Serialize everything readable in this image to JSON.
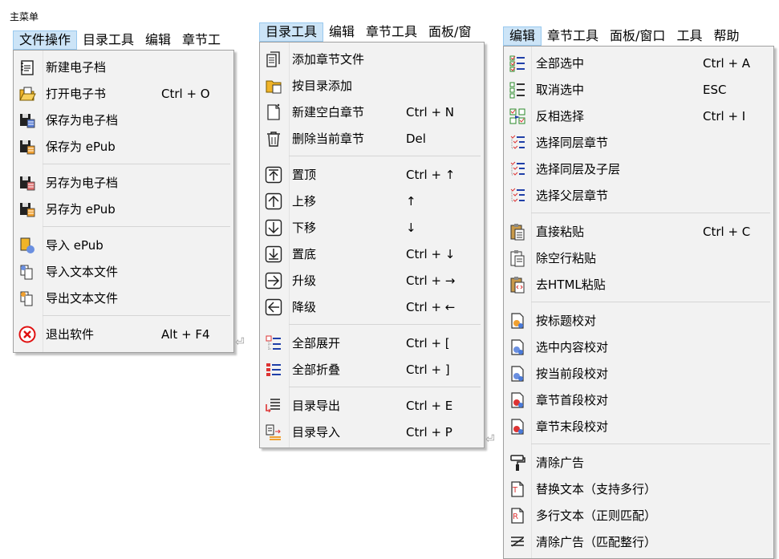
{
  "caption": "主菜单",
  "menu1": {
    "tabs": [
      "文件操作",
      "目录工具",
      "编辑",
      "章节工"
    ],
    "items": [
      {
        "label": "新建电子档",
        "shortcut": "",
        "icon": "new-ebook-icon"
      },
      {
        "label": "打开电子书",
        "shortcut": "Ctrl + O",
        "icon": "open-folder-icon"
      },
      {
        "label": "保存为电子档",
        "shortcut": "",
        "icon": "save-ebook-icon"
      },
      {
        "label": "保存为 ePub",
        "shortcut": "",
        "icon": "save-epub-icon"
      },
      {
        "label": "另存为电子档",
        "shortcut": "",
        "icon": "save-as-ebook-icon"
      },
      {
        "label": "另存为 ePub",
        "shortcut": "",
        "icon": "save-as-epub-icon"
      },
      {
        "label": "导入 ePub",
        "shortcut": "",
        "icon": "import-epub-icon"
      },
      {
        "label": "导入文本文件",
        "shortcut": "",
        "icon": "import-text-icon"
      },
      {
        "label": "导出文本文件",
        "shortcut": "",
        "icon": "export-text-icon"
      },
      {
        "label": "退出软件",
        "shortcut": "Alt + F4",
        "icon": "exit-icon"
      }
    ],
    "return_mark": "⏎"
  },
  "menu2": {
    "tabs": [
      "目录工具",
      "编辑",
      "章节工具",
      "面板/窗"
    ],
    "items": [
      {
        "label": "添加章节文件",
        "shortcut": "",
        "icon": "add-chapter-file-icon"
      },
      {
        "label": "按目录添加",
        "shortcut": "",
        "icon": "add-by-directory-icon"
      },
      {
        "label": "新建空白章节",
        "shortcut": "Ctrl + N",
        "icon": "new-blank-chapter-icon"
      },
      {
        "label": "删除当前章节",
        "shortcut": "Del",
        "icon": "trash-icon"
      },
      {
        "label": "置顶",
        "shortcut": "Ctrl + ↑",
        "icon": "move-top-icon"
      },
      {
        "label": "上移",
        "shortcut": "↑",
        "icon": "move-up-icon"
      },
      {
        "label": "下移",
        "shortcut": "↓",
        "icon": "move-down-icon"
      },
      {
        "label": "置底",
        "shortcut": "Ctrl + ↓",
        "icon": "move-bottom-icon"
      },
      {
        "label": "升级",
        "shortcut": "Ctrl + →",
        "icon": "promote-icon"
      },
      {
        "label": "降级",
        "shortcut": "Ctrl + ←",
        "icon": "demote-icon"
      },
      {
        "label": "全部展开",
        "shortcut": "Ctrl + [",
        "icon": "expand-all-icon"
      },
      {
        "label": "全部折叠",
        "shortcut": "Ctrl + ]",
        "icon": "collapse-all-icon"
      },
      {
        "label": "目录导出",
        "shortcut": "Ctrl + E",
        "icon": "toc-export-icon"
      },
      {
        "label": "目录导入",
        "shortcut": "Ctrl + P",
        "icon": "toc-import-icon"
      }
    ],
    "return_mark": "⏎"
  },
  "menu3": {
    "tabs": [
      "编辑",
      "章节工具",
      "面板/窗口",
      "工具",
      "帮助"
    ],
    "items": [
      {
        "label": "全部选中",
        "shortcut": "Ctrl + A",
        "icon": "select-all-icon"
      },
      {
        "label": "取消选中",
        "shortcut": "ESC",
        "icon": "deselect-icon"
      },
      {
        "label": "反相选择",
        "shortcut": "Ctrl + I",
        "icon": "invert-selection-icon"
      },
      {
        "label": "选择同层章节",
        "shortcut": "",
        "icon": "select-sibling-icon"
      },
      {
        "label": "选择同层及子层",
        "shortcut": "",
        "icon": "select-sibling-children-icon"
      },
      {
        "label": "选择父层章节",
        "shortcut": "",
        "icon": "select-parent-icon"
      },
      {
        "label": "直接粘贴",
        "shortcut": "Ctrl + C",
        "icon": "paste-icon"
      },
      {
        "label": "除空行粘贴",
        "shortcut": "",
        "icon": "paste-no-blank-icon"
      },
      {
        "label": "去HTML粘贴",
        "shortcut": "",
        "icon": "paste-strip-html-icon"
      },
      {
        "label": "按标题校对",
        "shortcut": "",
        "icon": "proof-title-icon"
      },
      {
        "label": "选中内容校对",
        "shortcut": "",
        "icon": "proof-selection-icon"
      },
      {
        "label": "按当前段校对",
        "shortcut": "",
        "icon": "proof-paragraph-icon"
      },
      {
        "label": "章节首段校对",
        "shortcut": "",
        "icon": "proof-first-paragraph-icon"
      },
      {
        "label": "章节末段校对",
        "shortcut": "",
        "icon": "proof-last-paragraph-icon"
      },
      {
        "label": "清除广告",
        "shortcut": "",
        "icon": "paint-roller-icon"
      },
      {
        "label": "替换文本（支持多行）",
        "shortcut": "",
        "icon": "replace-text-icon"
      },
      {
        "label": "多行文本（正则匹配）",
        "shortcut": "",
        "icon": "regex-text-icon"
      },
      {
        "label": "清除广告（匹配整行）",
        "shortcut": "",
        "icon": "clear-ad-line-icon"
      }
    ]
  },
  "colors": {
    "menu_bg": "#f2f2f2",
    "tab_active": "#cce4f7",
    "tab_border": "#99c9ef",
    "separator": "#d5d5d5"
  }
}
